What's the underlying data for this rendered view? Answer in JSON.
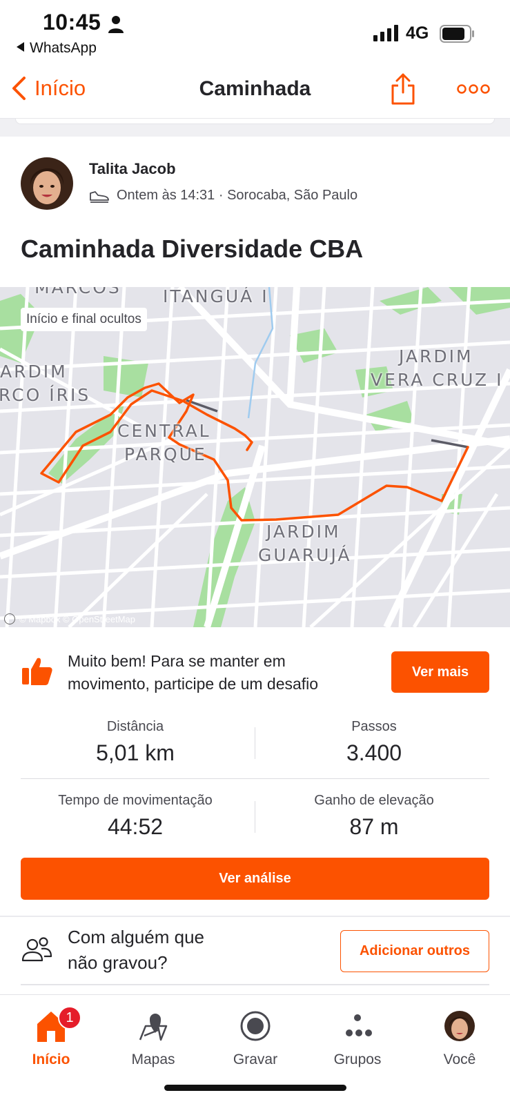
{
  "status_bar": {
    "time": "10:45",
    "back_app": "WhatsApp",
    "network": "4G"
  },
  "nav": {
    "back_label": "Início",
    "title": "Caminhada"
  },
  "activity": {
    "athlete": "Talita Jacob",
    "meta": "Ontem às 14:31 · Sorocaba, São Paulo",
    "title": "Caminhada Diversidade CBA"
  },
  "map": {
    "hidden_note": "Início e final ocultos",
    "labels": [
      "MARCOS",
      "ITANGUÁ I",
      "JARDIM",
      "VERA CRUZ I",
      "ARDIM",
      "RCO ÍRIS",
      "CENTRAL",
      "PARQUE",
      "JARDIM",
      "GUARUJÁ"
    ],
    "attribution": "© Mapbox © OpenStreetMap",
    "route_color": "#fc5200"
  },
  "challenge": {
    "text": "Muito bem! Para se manter em movimento, participe de um desafio",
    "button": "Ver mais"
  },
  "stats": [
    {
      "label": "Distância",
      "value": "5,01 km"
    },
    {
      "label": "Passos",
      "value": "3.400"
    },
    {
      "label": "Tempo de movimentação",
      "value": "44:52"
    },
    {
      "label": "Ganho de elevação",
      "value": "87 m"
    }
  ],
  "analysis_button": "Ver análise",
  "tag_others": {
    "text_line1": "Com alguém que",
    "text_line2": "não gravou?",
    "button": "Adicionar outros"
  },
  "tabs": [
    {
      "label": "Início",
      "badge": "1"
    },
    {
      "label": "Mapas"
    },
    {
      "label": "Gravar"
    },
    {
      "label": "Grupos"
    },
    {
      "label": "Você"
    }
  ],
  "colors": {
    "accent": "#fc5200",
    "text": "#242428",
    "badge": "#e51d2a"
  }
}
